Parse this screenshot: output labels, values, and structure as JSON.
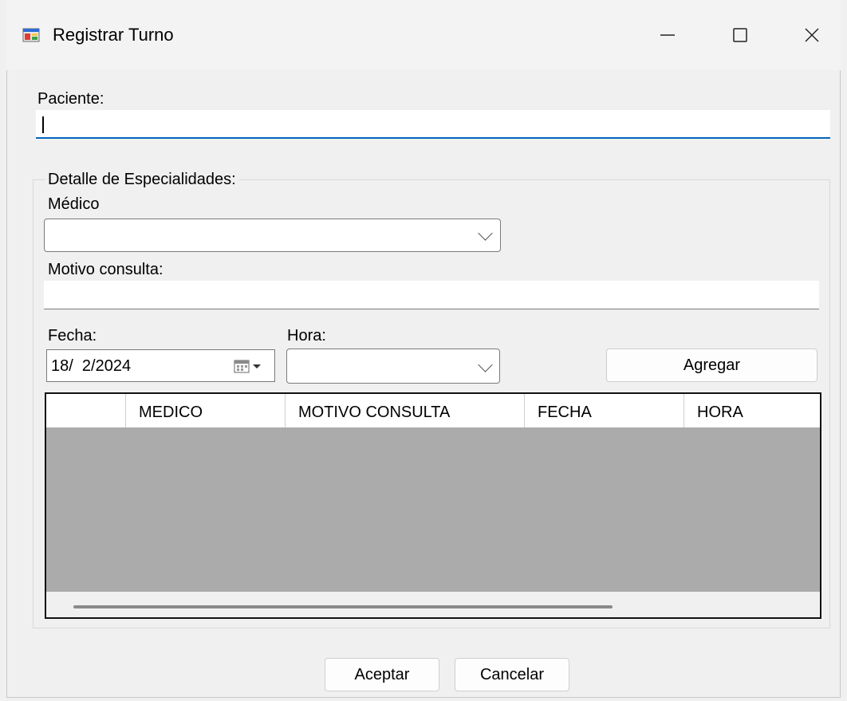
{
  "window": {
    "title": "Registrar Turno",
    "controls": {
      "minimize": "—",
      "maximize": "☐",
      "close": "✕"
    }
  },
  "form": {
    "paciente_label": "Paciente:",
    "paciente_value": "",
    "group_title": "Detalle de Especialidades:",
    "medico_label": "Médico",
    "medico_value": "",
    "motivo_label": "Motivo consulta:",
    "motivo_value": "",
    "fecha_label": "Fecha:",
    "fecha_value": "18/  2/2024",
    "hora_label": "Hora:",
    "hora_value": "",
    "agregar_label": "Agregar"
  },
  "grid": {
    "columns": [
      "",
      "MEDICO",
      "MOTIVO CONSULTA",
      "FECHA",
      "HORA"
    ],
    "rows": []
  },
  "footer": {
    "aceptar_label": "Aceptar",
    "cancelar_label": "Cancelar"
  },
  "colors": {
    "accent": "#0067c0",
    "grid_empty": "#ababab",
    "window_bg": "#f0f0f0"
  }
}
